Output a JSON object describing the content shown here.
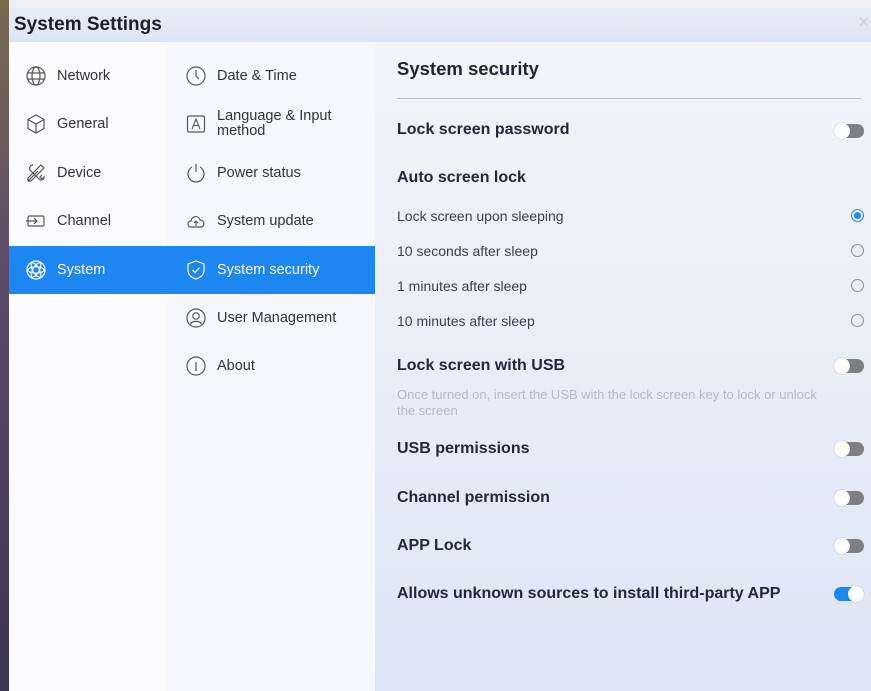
{
  "window": {
    "title": "System Settings",
    "close_glyph": "×"
  },
  "categories": [
    {
      "label": "Network",
      "icon": "globe-icon"
    },
    {
      "label": "General",
      "icon": "cube-icon"
    },
    {
      "label": "Device",
      "icon": "tools-icon"
    },
    {
      "label": "Channel",
      "icon": "input-icon"
    },
    {
      "label": "System",
      "icon": "atom-icon",
      "active": true
    }
  ],
  "subcategories": [
    {
      "label": "Date & Time",
      "icon": "clock-icon"
    },
    {
      "label": "Language & Input\nmethod",
      "icon": "language-icon"
    },
    {
      "label": "Power status",
      "icon": "power-icon"
    },
    {
      "label": "System update",
      "icon": "cloud-upload-icon"
    },
    {
      "label": "System security",
      "icon": "shield-check-icon",
      "active": true
    },
    {
      "label": "User Management",
      "icon": "user-icon"
    },
    {
      "label": "About",
      "icon": "info-icon"
    }
  ],
  "panel": {
    "title": "System security",
    "lock_password": {
      "label": "Lock screen password",
      "on": false
    },
    "auto_lock": {
      "label": "Auto screen lock",
      "options": [
        {
          "label": "Lock screen upon sleeping",
          "selected": true
        },
        {
          "label": "10 seconds after sleep",
          "selected": false
        },
        {
          "label": "1 minutes after sleep",
          "selected": false
        },
        {
          "label": "10 minutes after sleep",
          "selected": false
        }
      ]
    },
    "lock_usb": {
      "label": "Lock screen with USB",
      "on": false,
      "hint": "Once turned on, insert the USB with the lock screen key to lock or unlock the screen"
    },
    "usb_permissions": {
      "label": "USB permissions",
      "on": false
    },
    "channel_permission": {
      "label": "Channel permission",
      "on": false
    },
    "app_lock": {
      "label": "APP Lock",
      "on": false
    },
    "unknown_sources": {
      "label": "Allows unknown sources to install third-party APP",
      "on": true
    }
  },
  "colors": {
    "accent": "#1e86f0",
    "toggle_off": "#7d7f86"
  }
}
